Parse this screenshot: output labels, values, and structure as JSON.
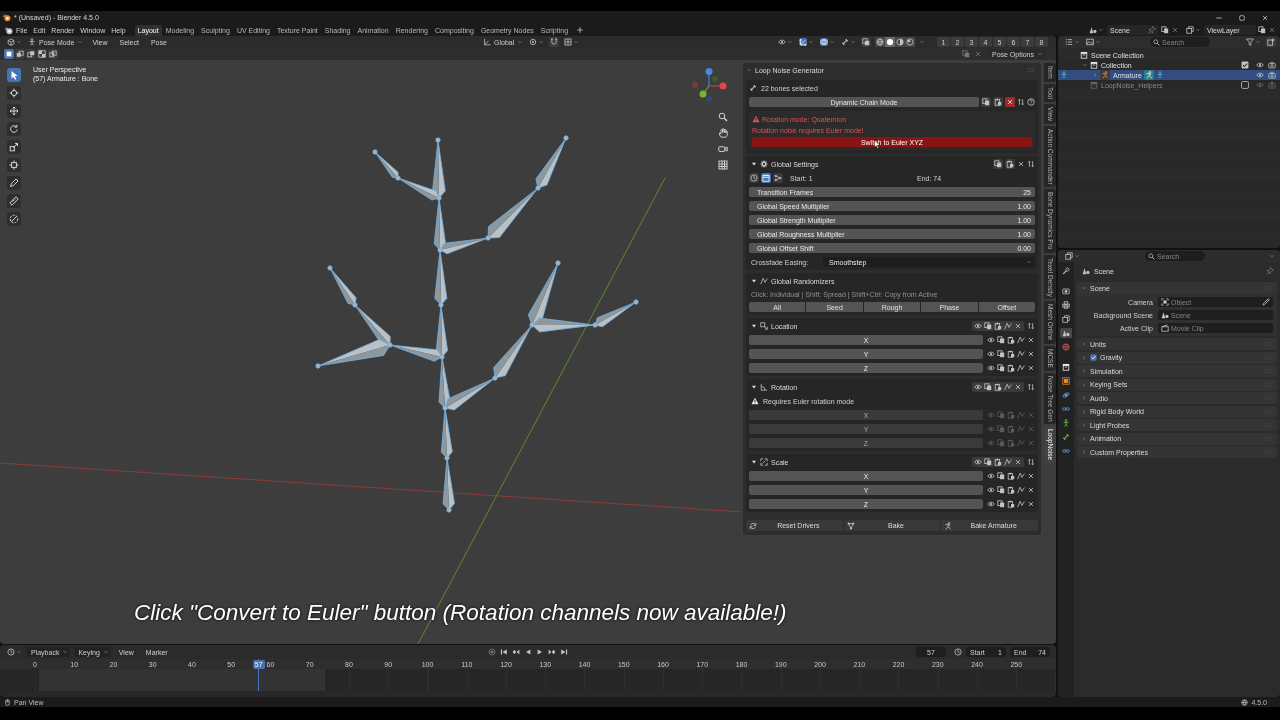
{
  "window": {
    "title": "* (Unsaved) - Blender 4.5.0"
  },
  "menu": [
    "File",
    "Edit",
    "Render",
    "Window",
    "Help"
  ],
  "workspaces": [
    {
      "label": "Layout",
      "selected": true
    },
    {
      "label": "Modeling",
      "selected": false
    },
    {
      "label": "Sculpting",
      "selected": false
    },
    {
      "label": "UV Editing",
      "selected": false
    },
    {
      "label": "Texture Paint",
      "selected": false
    },
    {
      "label": "Shading",
      "selected": false
    },
    {
      "label": "Animation",
      "selected": false
    },
    {
      "label": "Rendering",
      "selected": false
    },
    {
      "label": "Compositing",
      "selected": false
    },
    {
      "label": "Geometry Nodes",
      "selected": false
    },
    {
      "label": "Scripting",
      "selected": false
    }
  ],
  "scene": {
    "value": "Scene"
  },
  "view_layer": {
    "value": "ViewLayer"
  },
  "viewport": {
    "mode": "Pose Mode",
    "menus": [
      "View",
      "Select",
      "Pose"
    ],
    "orientation": "Global",
    "gizmos": {
      "on": true
    },
    "overlays": {
      "on": true
    },
    "shading": [
      {
        "selected": false
      },
      {
        "selected": true
      },
      {
        "selected": false
      },
      {
        "selected": false
      }
    ],
    "layers": [
      "1",
      "2",
      "3",
      "4",
      "5",
      "6",
      "7",
      "8"
    ],
    "select_modes": [
      {
        "selected": true
      },
      {
        "selected": false
      },
      {
        "selected": false
      },
      {
        "selected": false
      },
      {
        "selected": false
      }
    ],
    "pose_options": "Pose Options",
    "tools": [
      {
        "selected": true
      },
      {
        "selected": false
      },
      {
        "selected": false
      },
      {
        "selected": false
      },
      {
        "selected": false
      },
      {
        "selected": false
      },
      {
        "selected": false
      },
      {
        "selected": false
      },
      {
        "selected": false
      }
    ],
    "info": [
      "User Perspective",
      "(57) Armature : Bone"
    ],
    "caption": "Click \"Convert to Euler\" button (Rotation channels now available!)"
  },
  "sidebar": {
    "tabs": [
      {
        "label": "Item",
        "selected": false
      },
      {
        "label": "Tool",
        "selected": false
      },
      {
        "label": "View",
        "selected": false
      },
      {
        "label": "Action Commander",
        "selected": false
      },
      {
        "label": "Bone Dynamics Pro",
        "selected": false
      },
      {
        "label": "Texel Density",
        "selected": false
      },
      {
        "label": "Mesh Online",
        "selected": false
      },
      {
        "label": "MCSE",
        "selected": false
      },
      {
        "label": "Noise Tree Gen",
        "selected": false
      },
      {
        "label": "LoopNoise",
        "selected": true
      }
    ],
    "panel": {
      "title": "Loop Noise Generator",
      "expanded": true,
      "selection": "22 bones selected",
      "chain_button": "Dynamic Chain Mode",
      "warning": {
        "title": "Rotation mode: Quaternion",
        "message": "Rotation noise requires Euler mode!",
        "button": "Switch to Euler XYZ"
      },
      "global_settings": {
        "title": "Global Settings",
        "expanded": true,
        "frame_modes": [
          {
            "selected": false
          },
          {
            "selected": true
          },
          {
            "selected": false
          }
        ],
        "start": "Start: 1",
        "end": "End: 74",
        "fields": [
          {
            "label": "Transition Frames",
            "value": "25"
          },
          {
            "label": "Global Speed Multiplier",
            "value": "1.00"
          },
          {
            "label": "Global Strength Multiplier",
            "value": "1.00"
          },
          {
            "label": "Global Roughness Multiplier",
            "value": "1.00"
          },
          {
            "label": "Global Offset Shift",
            "value": "0.00"
          }
        ],
        "easing": {
          "label": "Crossfade Easing:",
          "value": "Smoothstep"
        }
      },
      "randomizers": {
        "title": "Global Randomizers",
        "expanded": true,
        "hint": "Click: Individual | Shift: Spread | Shift+Ctrl: Copy from Active",
        "buttons": [
          "All",
          "Seed",
          "Rough",
          "Phase",
          "Offset"
        ]
      },
      "channels": [
        {
          "title": "Location",
          "expanded": true,
          "disabled": false,
          "axes": [
            "X",
            "Y",
            "Z"
          ]
        },
        {
          "title": "Rotation",
          "expanded": true,
          "disabled": true,
          "warning": "Requires Euler rotation mode",
          "axes": [
            "X",
            "Y",
            "Z"
          ]
        },
        {
          "title": "Scale",
          "expanded": true,
          "disabled": false,
          "axes": [
            "X",
            "Y",
            "Z"
          ]
        }
      ],
      "footer": [
        "Reset Drivers",
        "Bake",
        "Bake Armature"
      ]
    }
  },
  "outliner": {
    "search": {
      "placeholder": "Search"
    },
    "items": [
      {
        "kind": "scene_collection",
        "label": "Scene Collection",
        "selected": false,
        "children": [
          {
            "kind": "collection",
            "label": "Collection",
            "selected": false,
            "expanded": true,
            "checked": true,
            "children": [
              {
                "kind": "armature",
                "label": "Armature",
                "selected": true,
                "expanded": false
              }
            ]
          },
          {
            "kind": "collection",
            "label": "LoopNoise_Helpers",
            "selected": false,
            "checked": false
          }
        ]
      }
    ]
  },
  "properties": {
    "search": {
      "placeholder": "Search"
    },
    "tabs": [
      {
        "selected": false
      },
      {
        "selected": false
      },
      {
        "selected": false
      },
      {
        "selected": false
      },
      {
        "selected": true
      },
      {
        "selected": false
      },
      {
        "selected": false
      },
      {
        "selected": false
      },
      {
        "selected": false
      },
      {
        "selected": false
      },
      {
        "selected": false
      },
      {
        "selected": false
      },
      {
        "selected": false
      }
    ],
    "context": "Scene",
    "panels": [
      {
        "label": "Scene",
        "kind": "plain",
        "expanded": true,
        "fields": [
          {
            "kind": "object",
            "label": "Camera",
            "placeholder": "Object"
          },
          {
            "kind": "scene",
            "label": "Background Scene",
            "placeholder": "Scene"
          },
          {
            "kind": "clip",
            "label": "Active Clip",
            "placeholder": "Movie Clip"
          }
        ]
      },
      {
        "label": "Units",
        "kind": "plain",
        "expanded": false
      },
      {
        "label": "Gravity",
        "kind": "toggle",
        "expanded": false,
        "checked": true
      },
      {
        "label": "Simulation",
        "kind": "plain",
        "expanded": false
      },
      {
        "label": "Keying Sets",
        "kind": "plain",
        "expanded": false
      },
      {
        "label": "Audio",
        "kind": "plain",
        "expanded": false
      },
      {
        "label": "Rigid Body World",
        "kind": "plain",
        "expanded": false
      },
      {
        "label": "Light Probes",
        "kind": "plain",
        "expanded": false
      },
      {
        "label": "Animation",
        "kind": "plain",
        "expanded": false
      },
      {
        "label": "Custom Properties",
        "kind": "plain",
        "expanded": false
      }
    ]
  },
  "timeline": {
    "menus": [
      {
        "label": "Playback",
        "kind": "dropdown"
      },
      {
        "label": "Keying",
        "kind": "dropdown"
      },
      {
        "label": "View",
        "kind": "menu"
      },
      {
        "label": "Marker",
        "kind": "menu"
      }
    ],
    "frame": "57",
    "start": {
      "label": "Start",
      "value": "1"
    },
    "end": {
      "label": "End",
      "value": "74"
    },
    "ruler": [
      "0",
      "10",
      "20",
      "30",
      "40",
      "50",
      "60",
      "70",
      "80",
      "90",
      "100",
      "110",
      "120",
      "130",
      "140",
      "150",
      "160",
      "170",
      "180",
      "190",
      "200",
      "210",
      "220",
      "230",
      "240",
      "250"
    ],
    "playhead": "57"
  },
  "status_bar": {
    "hint": "Pan View",
    "version": "4.5.0"
  }
}
